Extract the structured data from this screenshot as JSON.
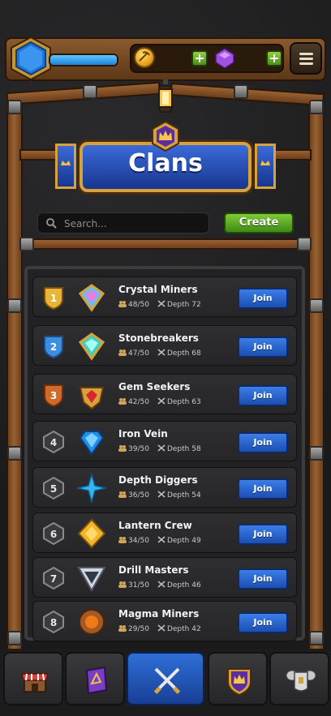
{
  "screen": {
    "title": "Clans"
  },
  "top_bar": {
    "xp_fill": 1.0
  },
  "search": {
    "placeholder": "Search..."
  },
  "create_label": "Create",
  "clans": [
    {
      "rank": "1",
      "name": "Crystal Miners",
      "members": "48/50",
      "depth": "Depth 72",
      "join_label": "Join"
    },
    {
      "rank": "2",
      "name": "Stonebreakers",
      "members": "47/50",
      "depth": "Depth 68",
      "join_label": "Join"
    },
    {
      "rank": "3",
      "name": "Gem Seekers",
      "members": "42/50",
      "depth": "Depth 63",
      "join_label": "Join"
    },
    {
      "rank": "4",
      "name": "Iron Vein",
      "members": "39/50",
      "depth": "Depth 58",
      "join_label": "Join"
    },
    {
      "rank": "5",
      "name": "Depth Diggers",
      "members": "36/50",
      "depth": "Depth 54",
      "join_label": "Join"
    },
    {
      "rank": "6",
      "name": "Lantern Crew",
      "members": "34/50",
      "depth": "Depth 49",
      "join_label": "Join"
    },
    {
      "rank": "7",
      "name": "Drill Masters",
      "members": "31/50",
      "depth": "Depth 46",
      "join_label": "Join"
    },
    {
      "rank": "8",
      "name": "Magma Miners",
      "members": "29/50",
      "depth": "Depth 42",
      "join_label": "Join"
    }
  ],
  "icons": {
    "profile": "blue-shield-hex-icon",
    "coin": "pickaxe-coin-icon",
    "gem": "purple-gem-icon",
    "menu": "hamburger-icon",
    "lantern": "lantern-icon",
    "search": "search-icon",
    "members": "members-icon",
    "depth": "crossed-pickaxes-icon"
  },
  "nav": [
    {
      "id": "shop",
      "icon": "shop-icon",
      "active": false
    },
    {
      "id": "spellbook",
      "icon": "spellbook-icon",
      "active": false
    },
    {
      "id": "battle",
      "icon": "crossed-swords-icon",
      "active": true
    },
    {
      "id": "clans",
      "icon": "clan-crest-icon",
      "active": false
    },
    {
      "id": "armor",
      "icon": "armor-icon",
      "active": false
    }
  ],
  "colors": {
    "accent_blue": "#1f5fd0",
    "accent_green": "#5aa820",
    "gold": "#d7a13c",
    "wood": "#8a5a2e"
  }
}
